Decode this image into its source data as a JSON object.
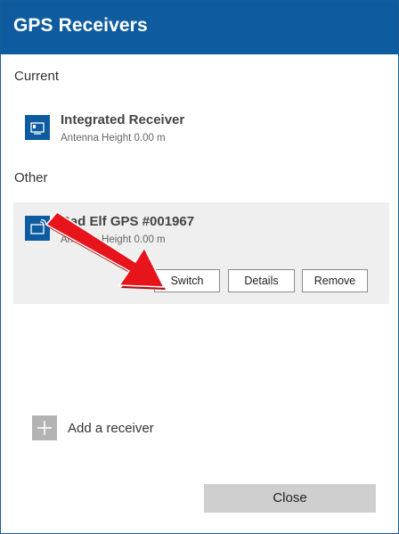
{
  "dialog": {
    "title": "GPS Receivers"
  },
  "current": {
    "section_label": "Current",
    "receiver": {
      "name": "Integrated Receiver",
      "subtitle": "Antenna Height 0.00 m",
      "icon": "monitor-icon"
    }
  },
  "other": {
    "section_label": "Other",
    "receiver": {
      "name": "Bad Elf GPS #001967",
      "subtitle": "Antenna Height 0.00 m",
      "icon": "bluetooth-device-icon"
    },
    "buttons": {
      "switch": "Switch",
      "details": "Details",
      "remove": "Remove"
    }
  },
  "add_receiver": {
    "label": "Add a receiver",
    "icon": "plus-icon"
  },
  "close": {
    "label": "Close"
  },
  "colors": {
    "accent": "#0e5c9f",
    "annotation_arrow": "#e8141b"
  }
}
